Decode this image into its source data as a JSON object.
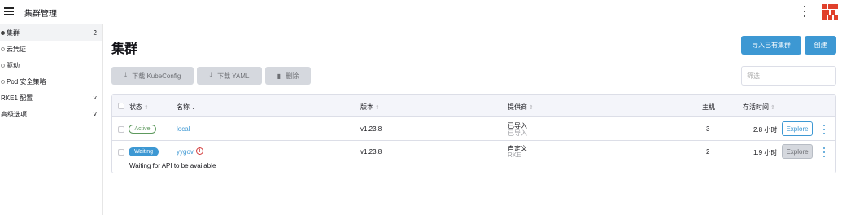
{
  "header": {
    "title": "集群管理"
  },
  "sidebar": {
    "items": [
      {
        "label": "集群",
        "count": "2"
      },
      {
        "label": "云凭证"
      },
      {
        "label": "驱动"
      },
      {
        "label": "Pod 安全策略"
      },
      {
        "label": "RKE1 配置",
        "chevron": "˅"
      },
      {
        "label": "高级选项",
        "chevron": "˅"
      }
    ]
  },
  "page": {
    "title": "集群",
    "import_label": "导入已有集群",
    "create_label": "创建"
  },
  "toolbar": {
    "kubeconfig_label": "下载 KubeConfig",
    "yaml_label": "下载 YAML",
    "delete_label": "删除",
    "download_icon": "⤓",
    "delete_icon": "🗑"
  },
  "filter": {
    "placeholder": "筛选"
  },
  "table": {
    "columns": {
      "state": "状态",
      "name": "名称",
      "version": "版本",
      "provider": "提供商",
      "hosts": "主机",
      "age": "存活时间"
    },
    "sort_icon": "⇕",
    "sort_down_icon": "⌄",
    "rows": [
      {
        "state": "Active",
        "name": "local",
        "version": "v1.23.8",
        "provider": "已导入",
        "provider_sub": "已导入",
        "hosts": "3",
        "age": "2.8 小时",
        "action": "Explore"
      },
      {
        "state": "Waiting",
        "name": "yygov",
        "version": "v1.23.8",
        "provider": "自定义",
        "provider_sub": "RKE",
        "hosts": "2",
        "age": "1.9 小时",
        "action": "Explore",
        "message": "Waiting for API to be available",
        "warn_icon": "!"
      }
    ]
  },
  "colors": {
    "accent": "#3d98d3",
    "active": "#5d995d",
    "warning": "#d33c3c",
    "logo": "#e0402b"
  }
}
